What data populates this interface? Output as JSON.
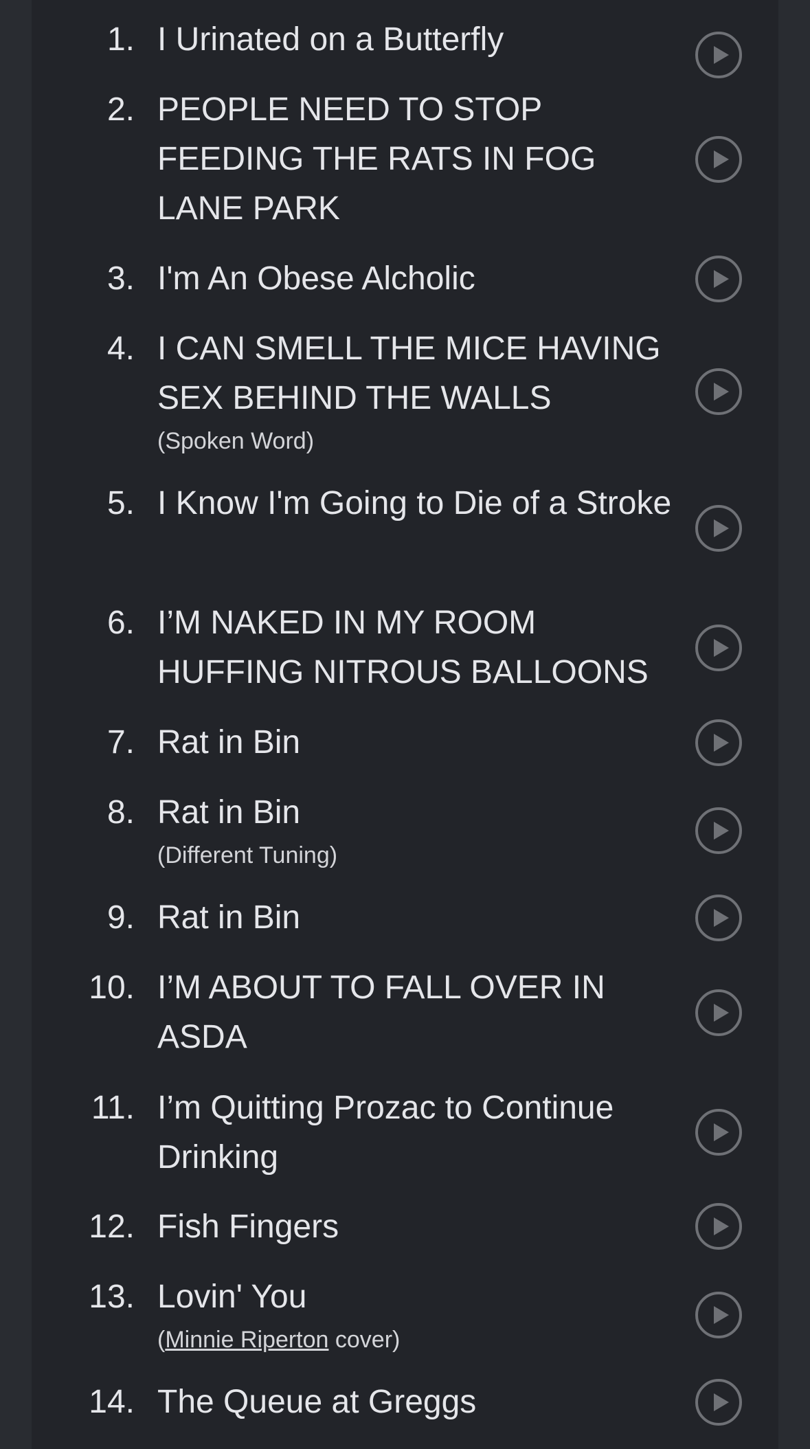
{
  "tracks": [
    {
      "num": "1.",
      "title": "I Urinated on a Butterfly"
    },
    {
      "num": "2.",
      "title": "PEOPLE NEED TO STOP FEEDING THE RATS IN FOG LANE PARK"
    },
    {
      "num": "3.",
      "title": "I'm An Obese Alcholic"
    },
    {
      "num": "4.",
      "title": "I CAN SMELL THE MICE HAVING SEX BEHIND THE WALLS",
      "note": "(Spoken Word)"
    },
    {
      "num": "5.",
      "title": "I Know I'm Going to Die of a Stroke"
    },
    {
      "num": "6.",
      "title": "I’M NAKED IN MY ROOM HUFFING NITROUS BALLOONS"
    },
    {
      "num": "7.",
      "title": "Rat in Bin"
    },
    {
      "num": "8.",
      "title": "Rat in Bin",
      "note": "(Different Tuning)"
    },
    {
      "num": "9.",
      "title": "Rat in Bin"
    },
    {
      "num": "10.",
      "title": "I’M ABOUT TO FALL OVER IN ASDA"
    },
    {
      "num": "11.",
      "title": "I’m Quitting Prozac to Continue Drinking"
    },
    {
      "num": "12.",
      "title": "Fish Fingers"
    },
    {
      "num": "13.",
      "title": "Lovin' You",
      "note_prefix": "(",
      "note_link": "Minnie Riperton",
      "note_suffix": " cover)"
    },
    {
      "num": "14.",
      "title": "The Queue at Greggs"
    }
  ],
  "icons": {
    "play": "play-circle-icon"
  },
  "colors": {
    "page_background": "#292c31",
    "panel_background": "#222429",
    "text": "#e5e6ea",
    "play_button": "#6f7176"
  }
}
